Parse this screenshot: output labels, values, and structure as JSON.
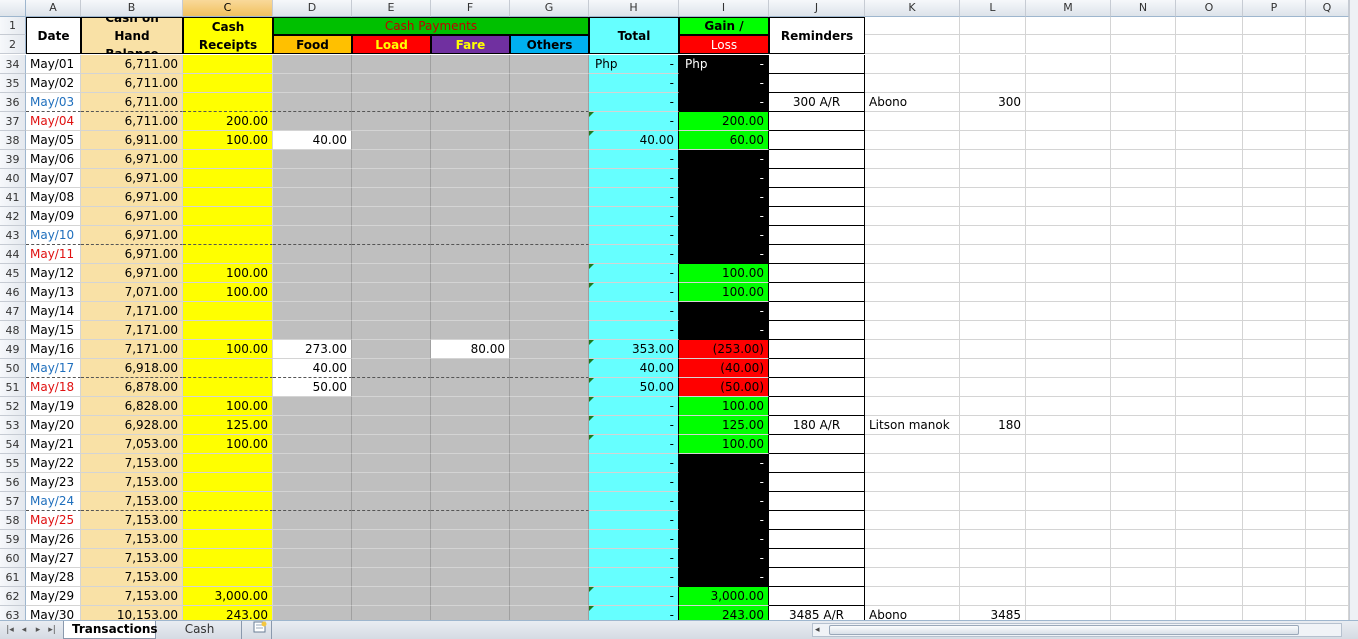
{
  "columns": [
    "A",
    "B",
    "C",
    "D",
    "E",
    "F",
    "G",
    "H",
    "I",
    "J",
    "K",
    "L",
    "M",
    "N",
    "O",
    "P",
    "Q"
  ],
  "header": {
    "date": "Date",
    "cash_on_hand": "Cash on Hand Balance",
    "cash_receipts": "Cash Receipts",
    "cash_payments": "Cash Payments",
    "food": "Food",
    "load": "Load",
    "fare": "Fare",
    "others": "Others",
    "total": "Total",
    "gain_loss_top": "Gain /",
    "gain_loss_bottom": "Loss",
    "reminders": "Reminders"
  },
  "rows": [
    {
      "n": "34",
      "date": "May/01",
      "dc": "black",
      "bal": "6,711.00",
      "rec": "",
      "food": "",
      "load": "",
      "fare": "",
      "others": "",
      "total_pre": "Php",
      "total": "-",
      "gl_pre": "Php",
      "gl": "-",
      "gl_bg": "black",
      "rem": "",
      "k": "",
      "l": ""
    },
    {
      "n": "35",
      "date": "May/02",
      "dc": "black",
      "bal": "6,711.00",
      "rec": "",
      "food": "",
      "load": "",
      "fare": "",
      "others": "",
      "total_pre": "",
      "total": "-",
      "gl_pre": "",
      "gl": "-",
      "gl_bg": "black",
      "rem": "",
      "k": "",
      "l": ""
    },
    {
      "n": "36",
      "date": "May/03",
      "dc": "blue",
      "bal": "6,711.00",
      "rec": "",
      "food": "",
      "load": "",
      "fare": "",
      "others": "",
      "total_pre": "",
      "total": "-",
      "gl_pre": "",
      "gl": "-",
      "gl_bg": "black",
      "rem": "300 A/R",
      "k": "Abono",
      "l": "300"
    },
    {
      "n": "37",
      "date": "May/04",
      "dc": "red",
      "bal": "6,711.00",
      "rec": "200.00",
      "food": "",
      "load": "",
      "fare": "",
      "others": "",
      "total_pre": "",
      "total": "-",
      "gl_pre": "",
      "gl": "200.00",
      "gl_bg": "green",
      "rem": "",
      "k": "",
      "l": ""
    },
    {
      "n": "38",
      "date": "May/05",
      "dc": "black",
      "bal": "6,911.00",
      "rec": "100.00",
      "food": "40.00",
      "load": "",
      "fare": "",
      "others": "",
      "total_pre": "",
      "total": "40.00",
      "gl_pre": "",
      "gl": "60.00",
      "gl_bg": "green",
      "rem": "",
      "k": "",
      "l": ""
    },
    {
      "n": "39",
      "date": "May/06",
      "dc": "black",
      "bal": "6,971.00",
      "rec": "",
      "food": "",
      "load": "",
      "fare": "",
      "others": "",
      "total_pre": "",
      "total": "-",
      "gl_pre": "",
      "gl": "-",
      "gl_bg": "black",
      "rem": "",
      "k": "",
      "l": ""
    },
    {
      "n": "40",
      "date": "May/07",
      "dc": "black",
      "bal": "6,971.00",
      "rec": "",
      "food": "",
      "load": "",
      "fare": "",
      "others": "",
      "total_pre": "",
      "total": "-",
      "gl_pre": "",
      "gl": "-",
      "gl_bg": "black",
      "rem": "",
      "k": "",
      "l": ""
    },
    {
      "n": "41",
      "date": "May/08",
      "dc": "black",
      "bal": "6,971.00",
      "rec": "",
      "food": "",
      "load": "",
      "fare": "",
      "others": "",
      "total_pre": "",
      "total": "-",
      "gl_pre": "",
      "gl": "-",
      "gl_bg": "black",
      "rem": "",
      "k": "",
      "l": ""
    },
    {
      "n": "42",
      "date": "May/09",
      "dc": "black",
      "bal": "6,971.00",
      "rec": "",
      "food": "",
      "load": "",
      "fare": "",
      "others": "",
      "total_pre": "",
      "total": "-",
      "gl_pre": "",
      "gl": "-",
      "gl_bg": "black",
      "rem": "",
      "k": "",
      "l": ""
    },
    {
      "n": "43",
      "date": "May/10",
      "dc": "blue",
      "bal": "6,971.00",
      "rec": "",
      "food": "",
      "load": "",
      "fare": "",
      "others": "",
      "total_pre": "",
      "total": "-",
      "gl_pre": "",
      "gl": "-",
      "gl_bg": "black",
      "rem": "",
      "k": "",
      "l": ""
    },
    {
      "n": "44",
      "date": "May/11",
      "dc": "red",
      "bal": "6,971.00",
      "rec": "",
      "food": "",
      "load": "",
      "fare": "",
      "others": "",
      "total_pre": "",
      "total": "-",
      "gl_pre": "",
      "gl": "-",
      "gl_bg": "black",
      "rem": "",
      "k": "",
      "l": ""
    },
    {
      "n": "45",
      "date": "May/12",
      "dc": "black",
      "bal": "6,971.00",
      "rec": "100.00",
      "food": "",
      "load": "",
      "fare": "",
      "others": "",
      "total_pre": "",
      "total": "-",
      "gl_pre": "",
      "gl": "100.00",
      "gl_bg": "green",
      "rem": "",
      "k": "",
      "l": ""
    },
    {
      "n": "46",
      "date": "May/13",
      "dc": "black",
      "bal": "7,071.00",
      "rec": "100.00",
      "food": "",
      "load": "",
      "fare": "",
      "others": "",
      "total_pre": "",
      "total": "-",
      "gl_pre": "",
      "gl": "100.00",
      "gl_bg": "green",
      "rem": "",
      "k": "",
      "l": ""
    },
    {
      "n": "47",
      "date": "May/14",
      "dc": "black",
      "bal": "7,171.00",
      "rec": "",
      "food": "",
      "load": "",
      "fare": "",
      "others": "",
      "total_pre": "",
      "total": "-",
      "gl_pre": "",
      "gl": "-",
      "gl_bg": "black",
      "rem": "",
      "k": "",
      "l": ""
    },
    {
      "n": "48",
      "date": "May/15",
      "dc": "black",
      "bal": "7,171.00",
      "rec": "",
      "food": "",
      "load": "",
      "fare": "",
      "others": "",
      "total_pre": "",
      "total": "-",
      "gl_pre": "",
      "gl": "-",
      "gl_bg": "black",
      "rem": "",
      "k": "",
      "l": ""
    },
    {
      "n": "49",
      "date": "May/16",
      "dc": "black",
      "bal": "7,171.00",
      "rec": "100.00",
      "food": "273.00",
      "load": "",
      "fare": "80.00",
      "others": "",
      "total_pre": "",
      "total": "353.00",
      "gl_pre": "",
      "gl": "(253.00)",
      "gl_bg": "red",
      "rem": "",
      "k": "",
      "l": ""
    },
    {
      "n": "50",
      "date": "May/17",
      "dc": "blue",
      "bal": "6,918.00",
      "rec": "",
      "food": "40.00",
      "load": "",
      "fare": "",
      "others": "",
      "total_pre": "",
      "total": "40.00",
      "gl_pre": "",
      "gl": "(40.00)",
      "gl_bg": "red",
      "rem": "",
      "k": "",
      "l": ""
    },
    {
      "n": "51",
      "date": "May/18",
      "dc": "red",
      "bal": "6,878.00",
      "rec": "",
      "food": "50.00",
      "load": "",
      "fare": "",
      "others": "",
      "total_pre": "",
      "total": "50.00",
      "gl_pre": "",
      "gl": "(50.00)",
      "gl_bg": "red",
      "rem": "",
      "k": "",
      "l": ""
    },
    {
      "n": "52",
      "date": "May/19",
      "dc": "black",
      "bal": "6,828.00",
      "rec": "100.00",
      "food": "",
      "load": "",
      "fare": "",
      "others": "",
      "total_pre": "",
      "total": "-",
      "gl_pre": "",
      "gl": "100.00",
      "gl_bg": "green",
      "rem": "",
      "k": "",
      "l": ""
    },
    {
      "n": "53",
      "date": "May/20",
      "dc": "black",
      "bal": "6,928.00",
      "rec": "125.00",
      "food": "",
      "load": "",
      "fare": "",
      "others": "",
      "total_pre": "",
      "total": "-",
      "gl_pre": "",
      "gl": "125.00",
      "gl_bg": "green",
      "rem": "180 A/R",
      "k": "Litson manok",
      "l": "180"
    },
    {
      "n": "54",
      "date": "May/21",
      "dc": "black",
      "bal": "7,053.00",
      "rec": "100.00",
      "food": "",
      "load": "",
      "fare": "",
      "others": "",
      "total_pre": "",
      "total": "-",
      "gl_pre": "",
      "gl": "100.00",
      "gl_bg": "green",
      "rem": "",
      "k": "",
      "l": ""
    },
    {
      "n": "55",
      "date": "May/22",
      "dc": "black",
      "bal": "7,153.00",
      "rec": "",
      "food": "",
      "load": "",
      "fare": "",
      "others": "",
      "total_pre": "",
      "total": "-",
      "gl_pre": "",
      "gl": "-",
      "gl_bg": "black",
      "rem": "",
      "k": "",
      "l": ""
    },
    {
      "n": "56",
      "date": "May/23",
      "dc": "black",
      "bal": "7,153.00",
      "rec": "",
      "food": "",
      "load": "",
      "fare": "",
      "others": "",
      "total_pre": "",
      "total": "-",
      "gl_pre": "",
      "gl": "-",
      "gl_bg": "black",
      "rem": "",
      "k": "",
      "l": ""
    },
    {
      "n": "57",
      "date": "May/24",
      "dc": "blue",
      "bal": "7,153.00",
      "rec": "",
      "food": "",
      "load": "",
      "fare": "",
      "others": "",
      "total_pre": "",
      "total": "-",
      "gl_pre": "",
      "gl": "-",
      "gl_bg": "black",
      "rem": "",
      "k": "",
      "l": ""
    },
    {
      "n": "58",
      "date": "May/25",
      "dc": "red",
      "bal": "7,153.00",
      "rec": "",
      "food": "",
      "load": "",
      "fare": "",
      "others": "",
      "total_pre": "",
      "total": "-",
      "gl_pre": "",
      "gl": "-",
      "gl_bg": "black",
      "rem": "",
      "k": "",
      "l": ""
    },
    {
      "n": "59",
      "date": "May/26",
      "dc": "black",
      "bal": "7,153.00",
      "rec": "",
      "food": "",
      "load": "",
      "fare": "",
      "others": "",
      "total_pre": "",
      "total": "-",
      "gl_pre": "",
      "gl": "-",
      "gl_bg": "black",
      "rem": "",
      "k": "",
      "l": ""
    },
    {
      "n": "60",
      "date": "May/27",
      "dc": "black",
      "bal": "7,153.00",
      "rec": "",
      "food": "",
      "load": "",
      "fare": "",
      "others": "",
      "total_pre": "",
      "total": "-",
      "gl_pre": "",
      "gl": "-",
      "gl_bg": "black",
      "rem": "",
      "k": "",
      "l": ""
    },
    {
      "n": "61",
      "date": "May/28",
      "dc": "black",
      "bal": "7,153.00",
      "rec": "",
      "food": "",
      "load": "",
      "fare": "",
      "others": "",
      "total_pre": "",
      "total": "-",
      "gl_pre": "",
      "gl": "-",
      "gl_bg": "black",
      "rem": "",
      "k": "",
      "l": ""
    },
    {
      "n": "62",
      "date": "May/29",
      "dc": "black",
      "bal": "7,153.00",
      "rec": "3,000.00",
      "food": "",
      "load": "",
      "fare": "",
      "others": "",
      "total_pre": "",
      "total": "-",
      "gl_pre": "",
      "gl": "3,000.00",
      "gl_bg": "green",
      "rem": "",
      "k": "",
      "l": ""
    },
    {
      "n": "63",
      "date": "May/30",
      "dc": "black",
      "bal": "10,153.00",
      "rec": "243.00",
      "food": "",
      "load": "",
      "fare": "",
      "others": "",
      "total_pre": "",
      "total": "-",
      "gl_pre": "",
      "gl": "243.00",
      "gl_bg": "green",
      "rem": "3485 A/R",
      "k": "Abono",
      "l": "3485"
    }
  ],
  "tabs": {
    "active": "Transactions",
    "other": "Cash Count"
  },
  "colors": {
    "yellow": "#ffff00",
    "tan": "#f9e1a6",
    "gray": "#bfbfbf",
    "cyan": "#66ffff",
    "green": "#00ff00",
    "black": "#000000",
    "red": "#ff0000",
    "blue_date": "#1f6fbd",
    "red_date": "#e01010",
    "food_hdr": "#ffc000",
    "load_hdr": "#ff0000",
    "fare_hdr": "#7030a0",
    "others_hdr": "#00b0f0"
  }
}
